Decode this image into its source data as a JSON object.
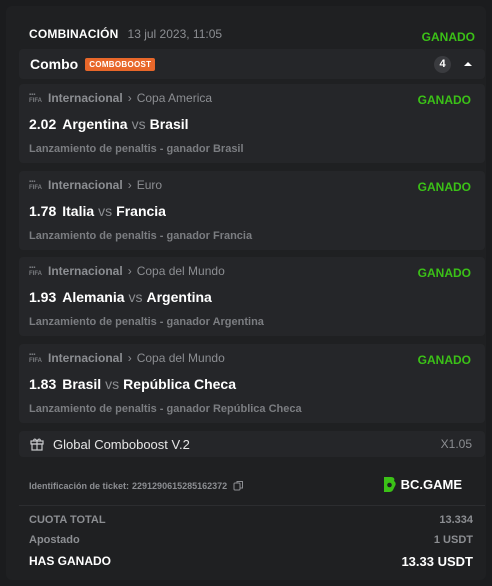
{
  "header": {
    "title": "COMBINACIÓN",
    "date": "13 jul 2023, 11:05",
    "status": "GANADO"
  },
  "combo": {
    "label": "Combo",
    "badge": "COMBOBOOST",
    "count": "4"
  },
  "bets": [
    {
      "league": "Internacional",
      "competition": "Copa America",
      "status": "GANADO",
      "odds": "2.02",
      "home": "Argentina",
      "vs": "vs",
      "away": "Brasil",
      "market": "Lanzamiento de penaltis - ganador Brasil"
    },
    {
      "league": "Internacional",
      "competition": "Euro",
      "status": "GANADO",
      "odds": "1.78",
      "home": "Italia",
      "vs": "vs",
      "away": "Francia",
      "market": "Lanzamiento de penaltis - ganador Francia"
    },
    {
      "league": "Internacional",
      "competition": "Copa del Mundo",
      "status": "GANADO",
      "odds": "1.93",
      "home": "Alemania",
      "vs": "vs",
      "away": "Argentina",
      "market": "Lanzamiento de penaltis - ganador Argentina"
    },
    {
      "league": "Internacional",
      "competition": "Copa del Mundo",
      "status": "GANADO",
      "odds": "1.83",
      "home": "Brasil",
      "vs": "vs",
      "away": "República Checa",
      "market": "Lanzamiento de penaltis - ganador República Checa"
    }
  ],
  "boost": {
    "label": "Global Comboboost V.2",
    "value": "X1.05"
  },
  "ticket": {
    "label": "Identificación de ticket:",
    "id": "2291290615285162372"
  },
  "brand": {
    "name": "BC.GAME"
  },
  "summary": {
    "total_odds_label": "CUOTA TOTAL",
    "total_odds": "13.334",
    "staked_label": "Apostado",
    "staked": "1 USDT",
    "won_label": "HAS GANADO",
    "won": "13.33 USDT"
  },
  "colors": {
    "win_green": "#3bc117",
    "boost_orange": "#e8672a",
    "card_bg": "#252629"
  }
}
